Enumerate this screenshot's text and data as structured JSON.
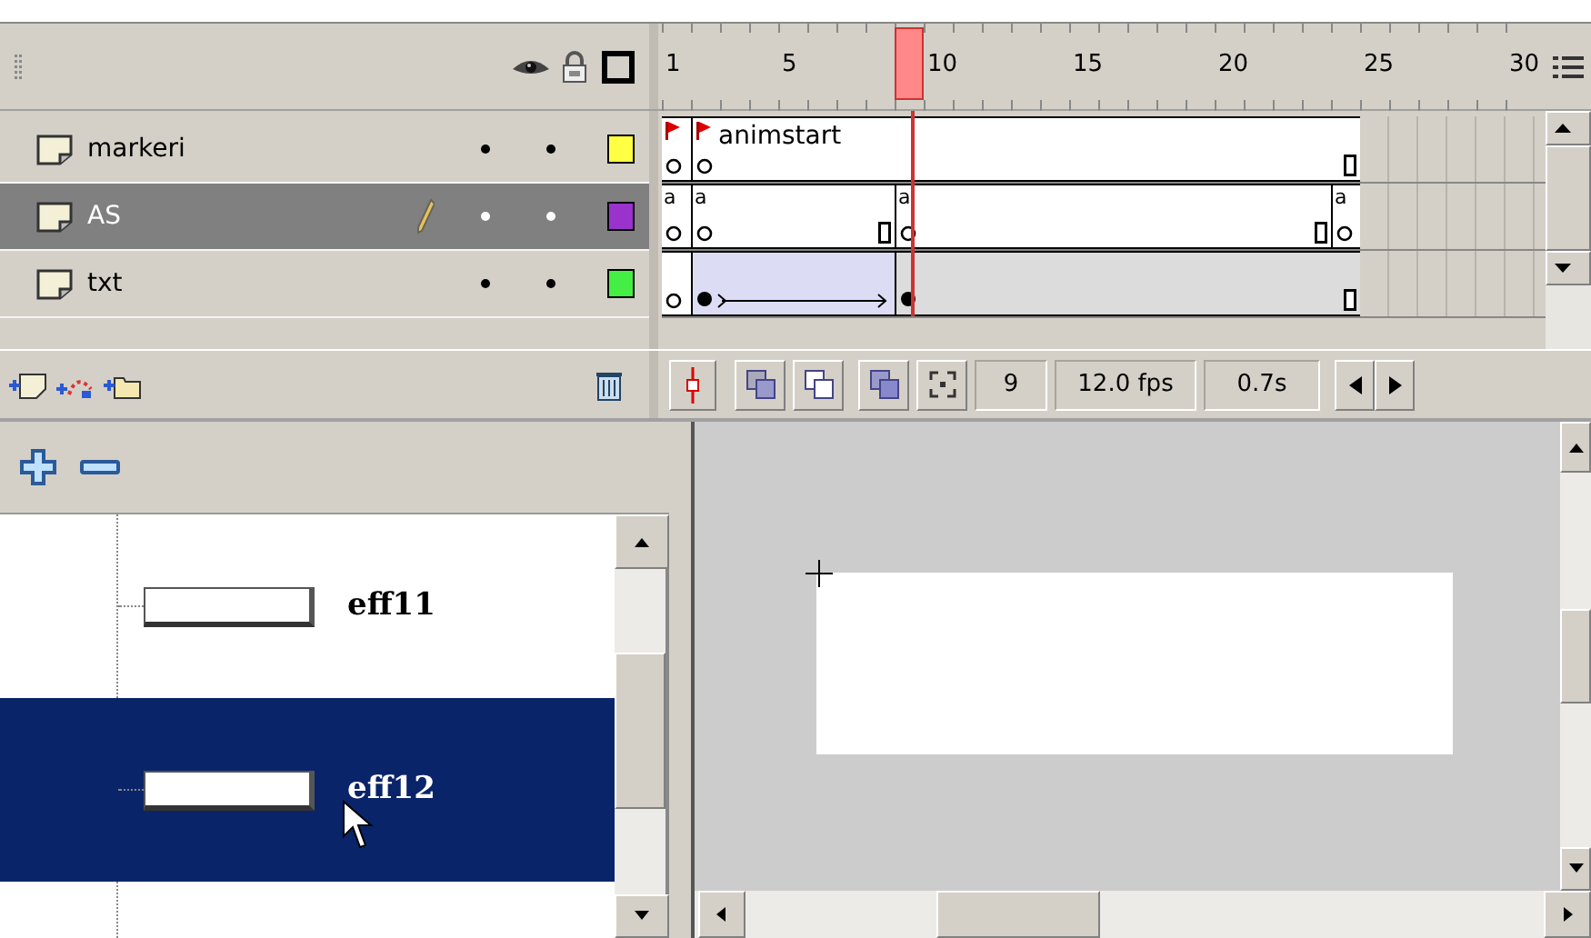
{
  "ruler": {
    "labels": [
      "1",
      "5",
      "10",
      "15",
      "20",
      "25",
      "30"
    ]
  },
  "layers": [
    {
      "name": "markeri",
      "selected": false,
      "editing": false,
      "color": "#ffff44",
      "cells": [
        {
          "kind": "flag-key"
        },
        {
          "kind": "flag-key",
          "label": "animstart"
        },
        {
          "kind": "hold"
        },
        {
          "kind": "hold"
        },
        {
          "kind": "hold"
        },
        {
          "kind": "hold"
        },
        {
          "kind": "hold"
        },
        {
          "kind": "hold"
        },
        {
          "kind": "hold"
        },
        {
          "kind": "hold"
        },
        {
          "kind": "hold"
        },
        {
          "kind": "hold"
        },
        {
          "kind": "hold"
        },
        {
          "kind": "hold"
        },
        {
          "kind": "hold"
        },
        {
          "kind": "hold"
        },
        {
          "kind": "hold"
        },
        {
          "kind": "hold"
        },
        {
          "kind": "hold"
        },
        {
          "kind": "hold"
        },
        {
          "kind": "hold"
        },
        {
          "kind": "hold"
        },
        {
          "kind": "hold"
        },
        {
          "kind": "hold-end"
        }
      ]
    },
    {
      "name": "AS",
      "selected": true,
      "editing": true,
      "color": "#9933cc",
      "cells": [
        {
          "kind": "action-key",
          "mark": "a"
        },
        {
          "kind": "action-key",
          "mark": "a"
        },
        {
          "kind": "hold"
        },
        {
          "kind": "hold"
        },
        {
          "kind": "hold"
        },
        {
          "kind": "hold"
        },
        {
          "kind": "hold"
        },
        {
          "kind": "hold-end"
        },
        {
          "kind": "action-key",
          "mark": "a"
        },
        {
          "kind": "hold"
        },
        {
          "kind": "hold"
        },
        {
          "kind": "hold"
        },
        {
          "kind": "hold"
        },
        {
          "kind": "hold"
        },
        {
          "kind": "hold"
        },
        {
          "kind": "hold"
        },
        {
          "kind": "hold"
        },
        {
          "kind": "hold"
        },
        {
          "kind": "hold"
        },
        {
          "kind": "hold"
        },
        {
          "kind": "hold"
        },
        {
          "kind": "hold"
        },
        {
          "kind": "hold-end"
        },
        {
          "kind": "action-key",
          "mark": "a"
        }
      ]
    },
    {
      "name": "txt",
      "selected": false,
      "editing": false,
      "color": "#44ee44",
      "cells": [
        {
          "kind": "blank-key"
        },
        {
          "kind": "tween-key"
        },
        {
          "kind": "tween"
        },
        {
          "kind": "tween"
        },
        {
          "kind": "tween"
        },
        {
          "kind": "tween"
        },
        {
          "kind": "tween"
        },
        {
          "kind": "tween"
        },
        {
          "kind": "shape-key"
        },
        {
          "kind": "shape-hold"
        },
        {
          "kind": "shape-hold"
        },
        {
          "kind": "shape-hold"
        },
        {
          "kind": "shape-hold"
        },
        {
          "kind": "shape-hold"
        },
        {
          "kind": "shape-hold"
        },
        {
          "kind": "shape-hold"
        },
        {
          "kind": "shape-hold"
        },
        {
          "kind": "shape-hold"
        },
        {
          "kind": "shape-hold"
        },
        {
          "kind": "shape-hold"
        },
        {
          "kind": "shape-hold"
        },
        {
          "kind": "shape-hold"
        },
        {
          "kind": "shape-hold"
        },
        {
          "kind": "shape-end"
        }
      ]
    }
  ],
  "status": {
    "frame": "9",
    "fps": "12.0 fps",
    "time": "0.7s"
  },
  "tree": {
    "items": [
      {
        "label": "eff11",
        "selected": false
      },
      {
        "label": "eff12",
        "selected": true
      }
    ]
  }
}
